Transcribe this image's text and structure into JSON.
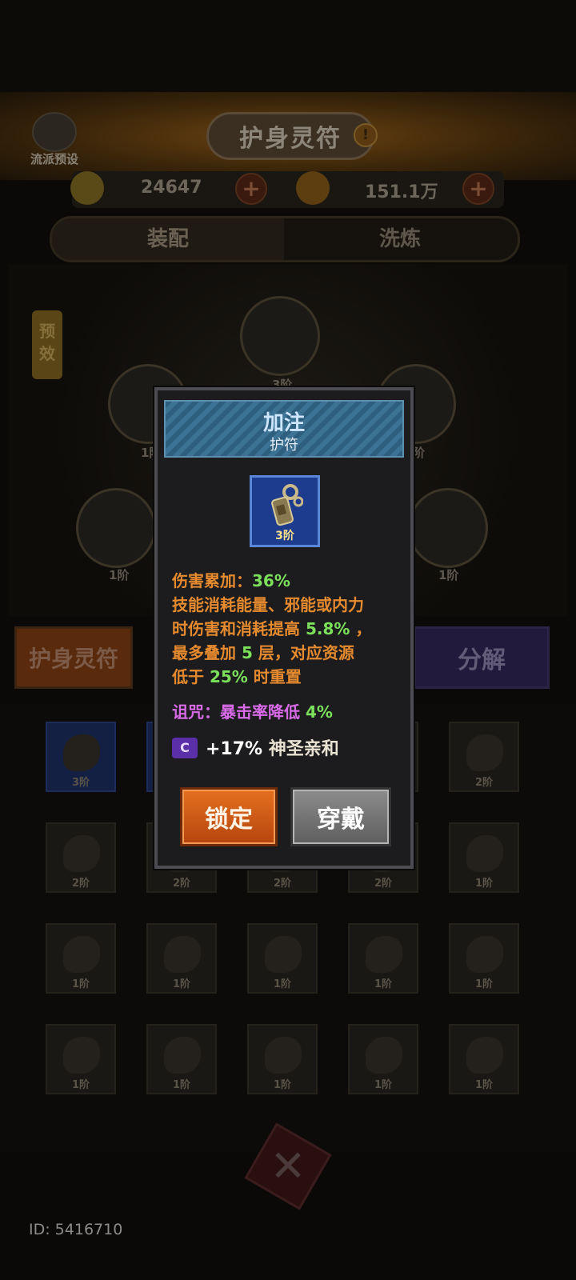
{
  "header": {
    "title": "护身灵符",
    "info_icon": "!",
    "preset_label": "流派预设"
  },
  "resources": {
    "currency1_value": "24647",
    "currency2_value": "151.1万",
    "plus": "+"
  },
  "tabs": [
    {
      "label": "装配"
    },
    {
      "label": "洗炼"
    }
  ],
  "side_tag": "预效",
  "slot_tiers": {
    "top": "3阶",
    "mid_left": "1阶",
    "mid_right": "阶",
    "bot_left": "1阶",
    "bot_right": "1阶"
  },
  "buttons": {
    "amulet": "护身灵符",
    "decompose": "分解"
  },
  "inventory": [
    [
      "3阶",
      "",
      "",
      "",
      "2阶"
    ],
    [
      "2阶",
      "2阶",
      "2阶",
      "2阶",
      "1阶"
    ],
    [
      "1阶",
      "1阶",
      "1阶",
      "1阶",
      "1阶"
    ],
    [
      "1阶",
      "1阶",
      "1阶",
      "1阶",
      "1阶"
    ]
  ],
  "modal": {
    "title": "加注",
    "subtitle": "护符",
    "item_tier": "3阶",
    "lines": [
      {
        "text": "伤害累加：",
        "value": "36%"
      },
      {
        "text": "技能消耗能量、邪能或内力"
      },
      {
        "text": "时伤害和消耗提高 ",
        "value": "5.8%",
        "tail": " ，"
      },
      {
        "text": "最多叠加 ",
        "value": "5",
        "tail": " 层，对应资源"
      },
      {
        "text": "低于 ",
        "value": "25%",
        "tail": " 时重置"
      }
    ],
    "curse_text": "诅咒：暴击率降低 ",
    "curse_value": "4%",
    "affix_badge": "C",
    "affix_value": "+17%",
    "affix_name": " 神圣亲和",
    "lock_label": "锁定",
    "wear_label": "穿戴"
  },
  "footer": {
    "id_text": "ID: 5416710"
  },
  "colors": {
    "accent_orange": "#e58a2e",
    "value_green": "#7be05a",
    "curse_pink": "#d96be8",
    "rarity_blue": "#1d3c8e"
  }
}
